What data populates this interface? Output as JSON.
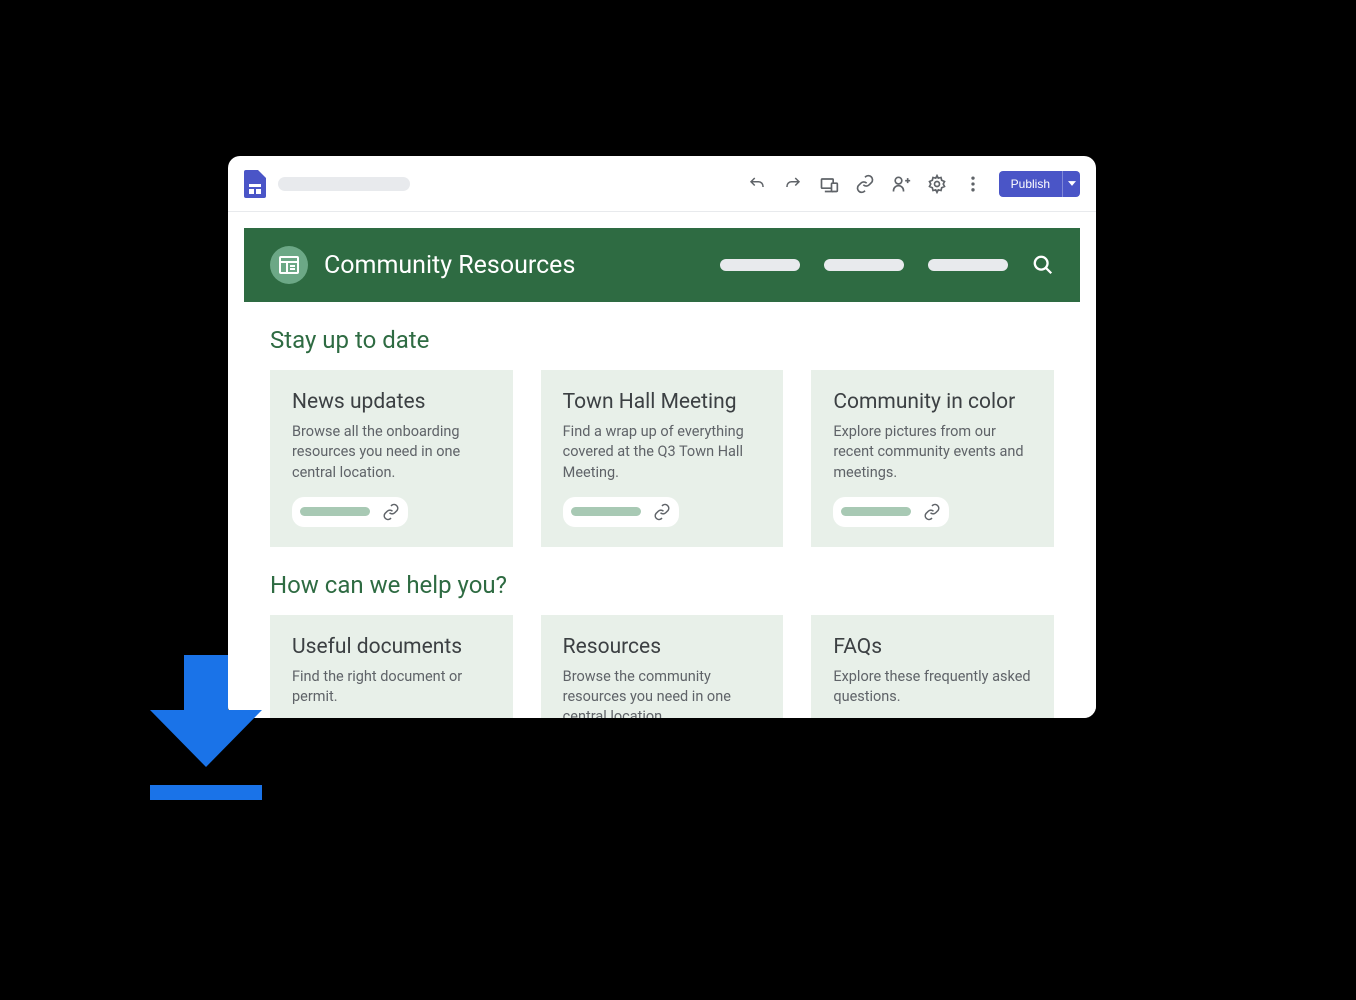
{
  "toolbar": {
    "publish_label": "Publish"
  },
  "site": {
    "title": "Community Resources"
  },
  "sections": [
    {
      "title": "Stay up to date",
      "cards": [
        {
          "title": "News updates",
          "description": "Browse all the onboarding resources you need in one central location."
        },
        {
          "title": "Town Hall Meeting",
          "description": "Find a wrap up of everything covered at the Q3 Town Hall Meeting."
        },
        {
          "title": "Community in color",
          "description": "Explore pictures from our recent community events and meetings."
        }
      ]
    },
    {
      "title": "How can we help you?",
      "cards": [
        {
          "title": "Useful documents",
          "description": "Find the right document or permit."
        },
        {
          "title": "Resources",
          "description": "Browse the community resources you need in one central location."
        },
        {
          "title": "FAQs",
          "description": "Explore these frequently asked questions."
        }
      ]
    }
  ]
}
